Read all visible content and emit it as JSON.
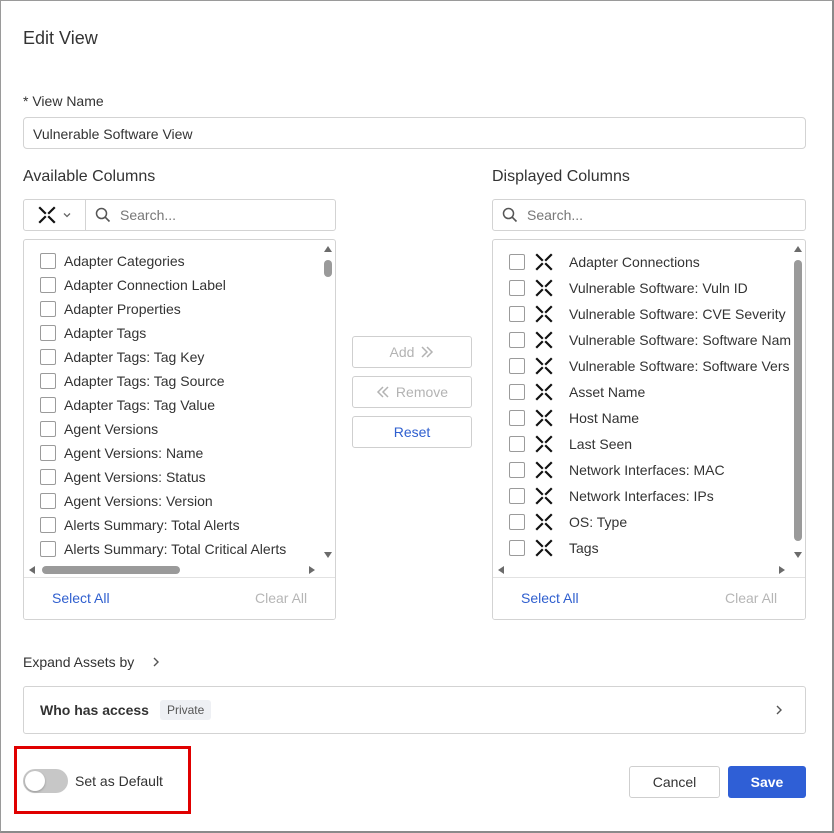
{
  "dialog": {
    "title": "Edit View",
    "view_name_label": "* View Name",
    "view_name_value": "Vulnerable Software View"
  },
  "available": {
    "title": "Available Columns",
    "search_placeholder": "Search...",
    "items": [
      "Adapter Categories",
      "Adapter Connection Label",
      "Adapter Properties",
      "Adapter Tags",
      "Adapter Tags: Tag Key",
      "Adapter Tags: Tag Source",
      "Adapter Tags: Tag Value",
      "Agent Versions",
      "Agent Versions: Name",
      "Agent Versions: Status",
      "Agent Versions: Version",
      "Alerts Summary: Total Alerts",
      "Alerts Summary: Total Critical Alerts"
    ],
    "select_all": "Select All",
    "clear_all": "Clear All"
  },
  "displayed": {
    "title": "Displayed Columns",
    "search_placeholder": "Search...",
    "items": [
      "Adapter Connections",
      "Vulnerable Software: Vuln ID",
      "Vulnerable Software: CVE Severity",
      "Vulnerable Software: Software Nam",
      "Vulnerable Software: Software Vers",
      "Asset Name",
      "Host Name",
      "Last Seen",
      "Network Interfaces: MAC",
      "Network Interfaces: IPs",
      "OS: Type",
      "Tags"
    ],
    "select_all": "Select All",
    "clear_all": "Clear All"
  },
  "actions": {
    "add": "Add",
    "remove": "Remove",
    "reset": "Reset"
  },
  "expand": {
    "label": "Expand Assets by"
  },
  "access": {
    "title": "Who has access",
    "badge": "Private"
  },
  "default_toggle": {
    "label": "Set as Default",
    "on": false
  },
  "footer": {
    "cancel": "Cancel",
    "save": "Save"
  },
  "colors": {
    "accent": "#2f5fd6",
    "link": "#2f5fcf",
    "highlight": "#e00000"
  },
  "icons": [
    "adapter-icon",
    "search-icon",
    "chevron-down-icon",
    "chevron-right-icon",
    "double-chevron-right-icon",
    "double-chevron-left-icon"
  ]
}
